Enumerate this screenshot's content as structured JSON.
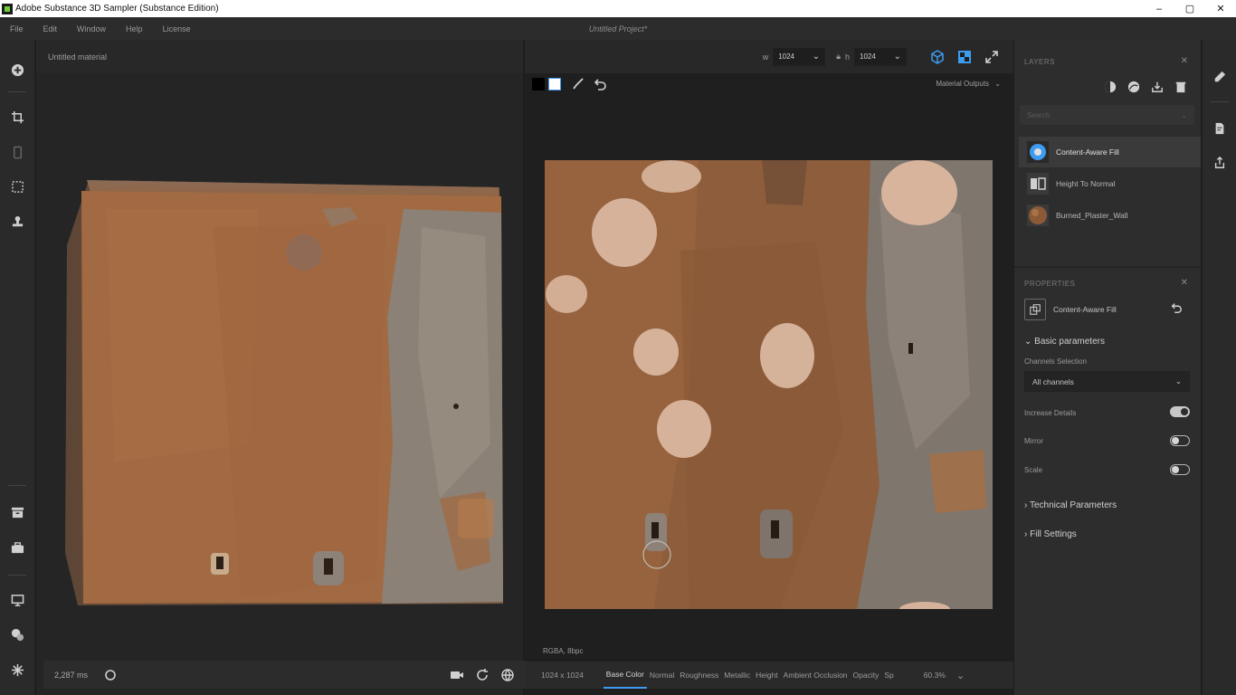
{
  "window": {
    "title": "Adobe Substance 3D Sampler (Substance Edition)",
    "minimize": "–",
    "maximize": "▢",
    "close": "✕"
  },
  "menu": {
    "items": [
      "File",
      "Edit",
      "Window",
      "Help",
      "License"
    ],
    "project_title": "Untitled Project*"
  },
  "left_toolbar": {
    "icons": [
      "add-icon",
      "crop-icon",
      "phone-icon",
      "selection-icon",
      "stamp-icon",
      "archive-icon",
      "toolbox-icon",
      "monitor-icon",
      "materials-icon",
      "snowflake-icon"
    ]
  },
  "viewport3d": {
    "material_name": "Untitled material",
    "render_time": "2,287 ms",
    "bottom_icons": [
      "camera-icon",
      "rotate-icon",
      "globe-icon",
      "environment-icon"
    ]
  },
  "viewport2d": {
    "width_label": "w",
    "width_value": "1024",
    "height_label": "h",
    "height_value": "1024",
    "material_outputs": "Material Outputs",
    "pixel_info": "RGBA, 8bpc",
    "resolution": "1024 x 1024",
    "channels": [
      "Base Color",
      "Normal",
      "Roughness",
      "Metallic",
      "Height",
      "Ambient Occlusion",
      "Opacity",
      "Sp"
    ],
    "active_channel": "Base Color",
    "zoom": "60.3%"
  },
  "layers": {
    "header": "LAYERS",
    "search_placeholder": "Search",
    "items": [
      {
        "label": "Content-Aware Fill",
        "selected": true
      },
      {
        "label": "Height To Normal",
        "selected": false
      },
      {
        "label": "Burned_Plaster_Wall",
        "selected": false
      }
    ]
  },
  "properties": {
    "header": "PROPERTIES",
    "layer_name": "Content-Aware Fill",
    "basic_parameters": "Basic parameters",
    "channels_selection_label": "Channels Selection",
    "channels_selection_value": "All channels",
    "increase_details": {
      "label": "Increase Details",
      "on": true
    },
    "mirror": {
      "label": "Mirror",
      "on": false
    },
    "scale": {
      "label": "Scale",
      "on": false
    },
    "technical_parameters": "Technical Parameters",
    "fill_settings": "Fill Settings"
  },
  "colors": {
    "accent": "#3d9bf0",
    "panel_bg": "#2d2d2d",
    "viewport_bg": "#252525"
  }
}
